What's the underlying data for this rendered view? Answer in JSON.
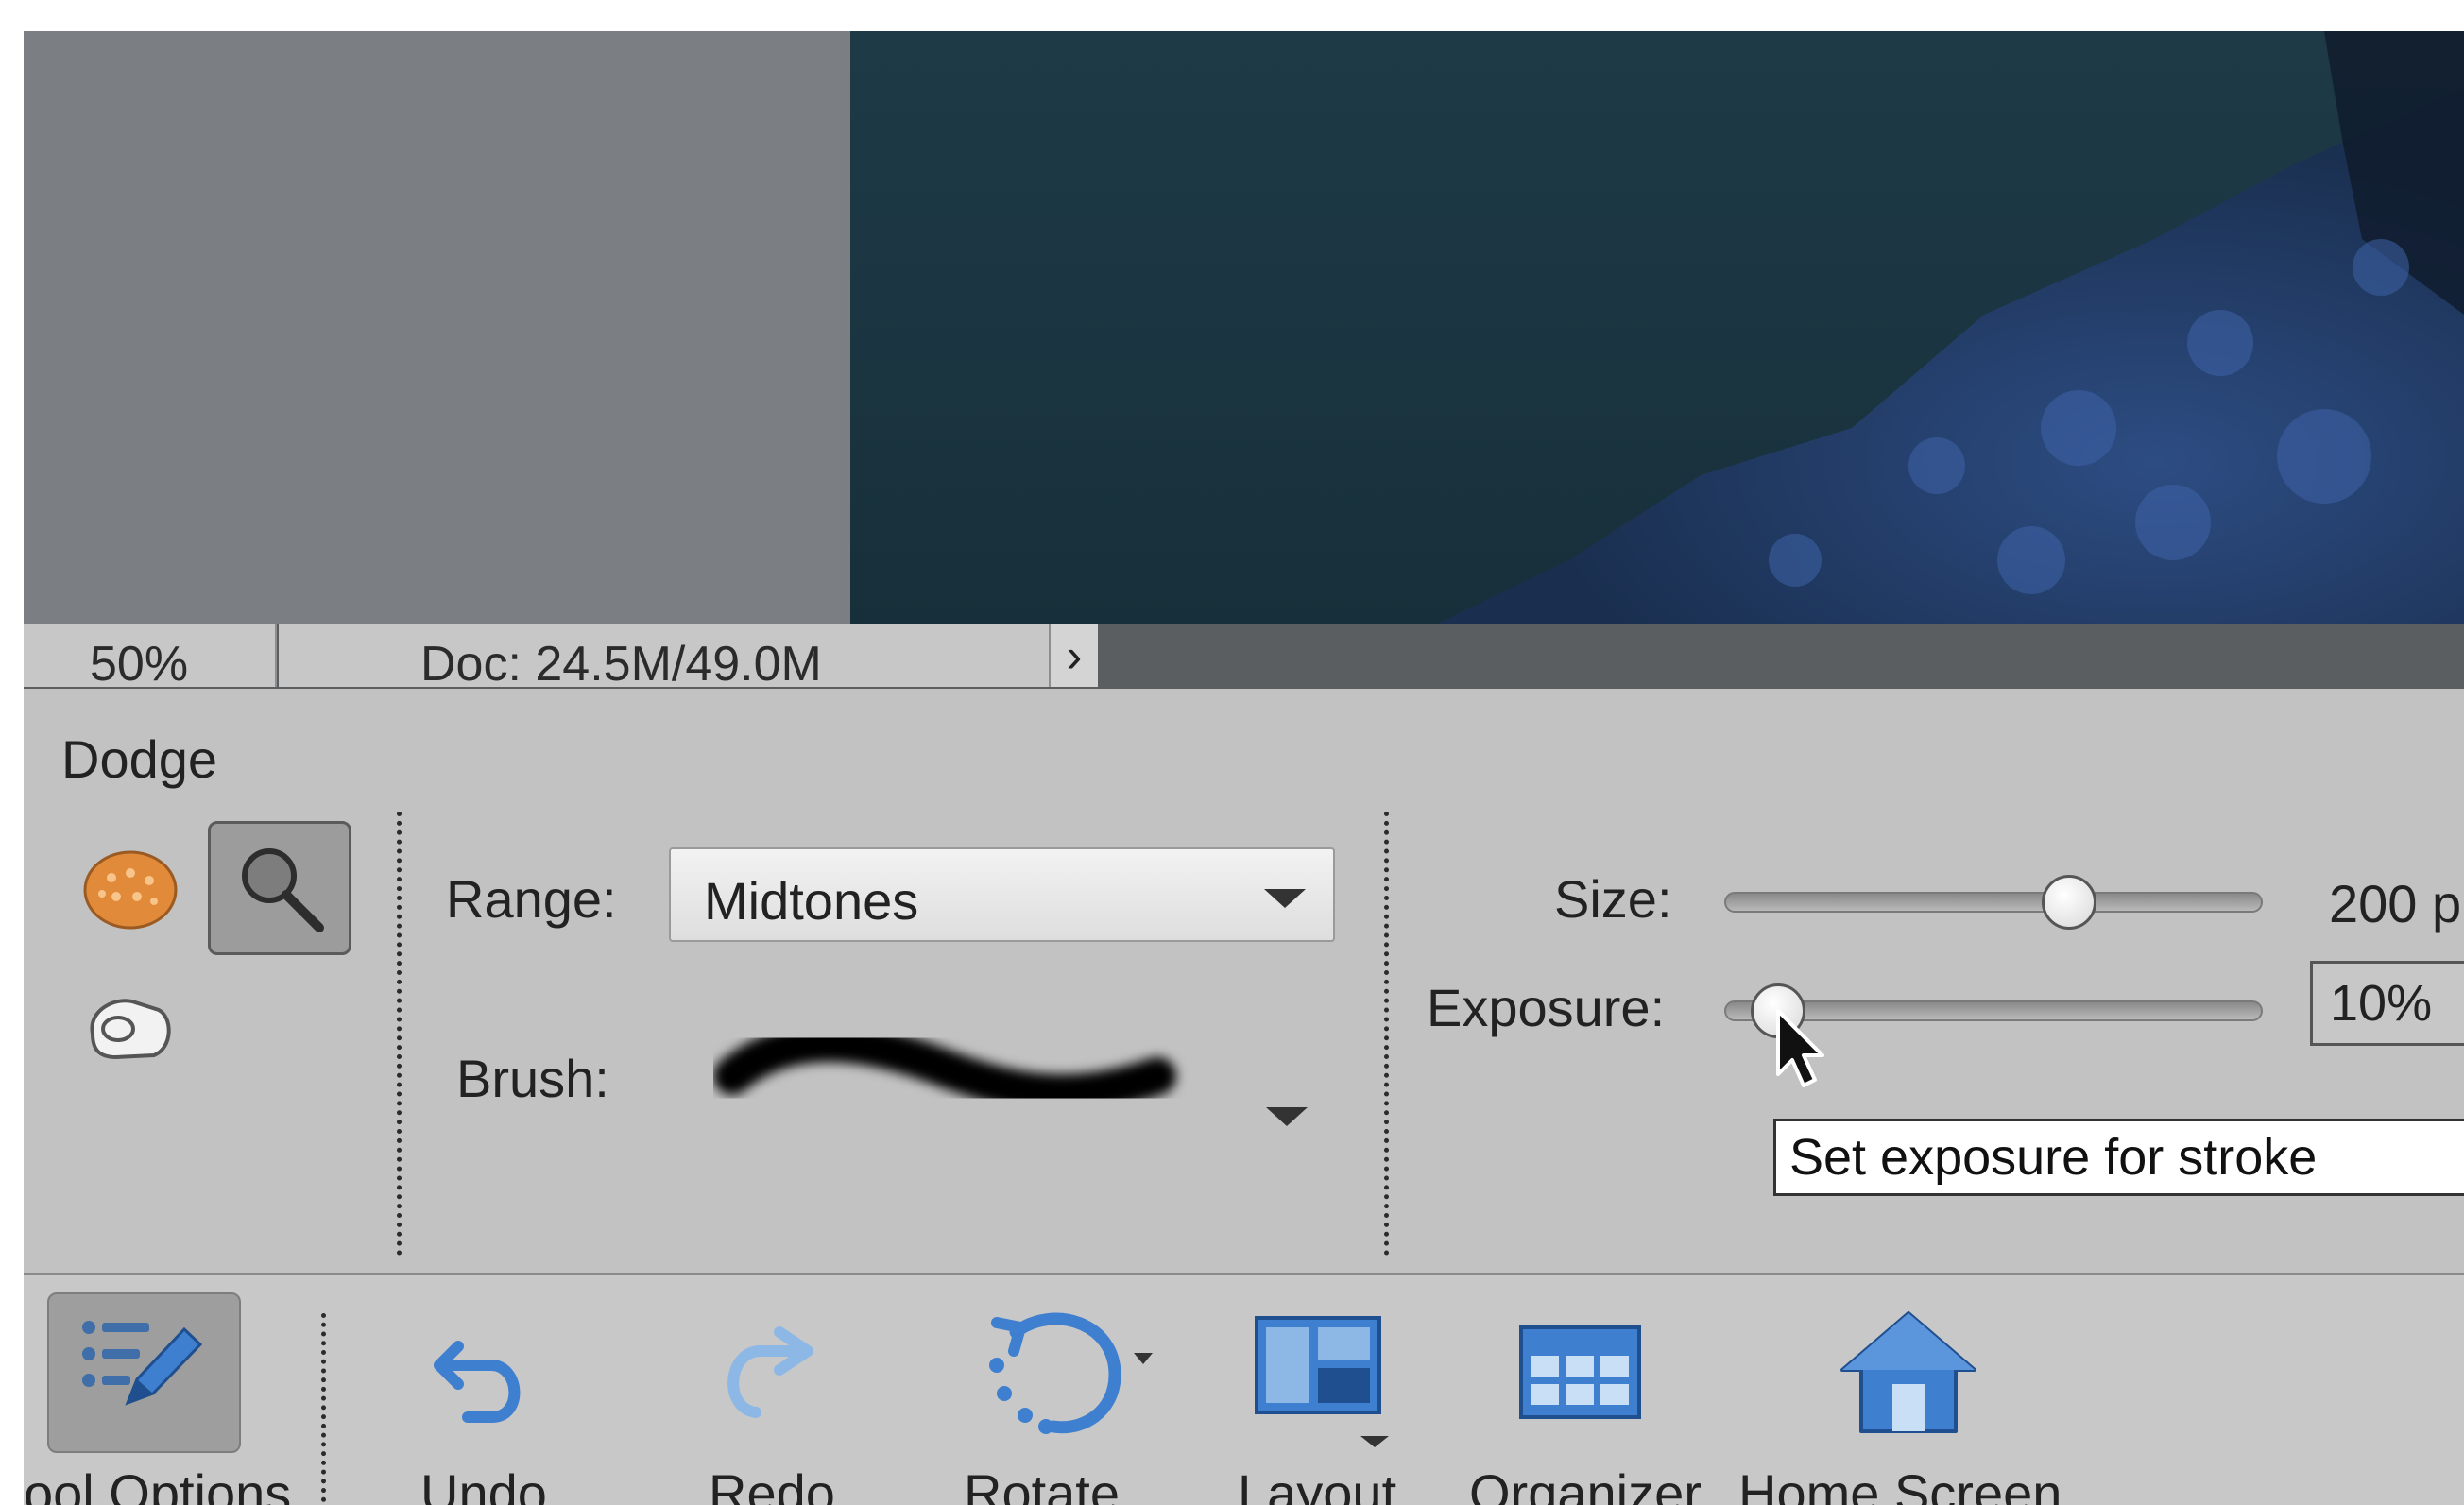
{
  "status_bar": {
    "zoom": "50%",
    "doc_info": "Doc: 24.5M/49.0M",
    "arrow": "›"
  },
  "tool_options": {
    "tool_name": "Dodge",
    "range_label": "Range:",
    "range_value": "Midtones",
    "brush_label": "Brush:",
    "size_label": "Size:",
    "size_value": "200 p",
    "size_level": 0.64,
    "exposure_label": "Exposure:",
    "exposure_value": "10%",
    "exposure_level": 0.1,
    "tooltip": "Set exposure for stroke"
  },
  "taskbar": {
    "items": [
      {
        "label": "ool Options",
        "icon": "tool-options-icon"
      },
      {
        "label": "Undo",
        "icon": "undo-icon"
      },
      {
        "label": "Redo",
        "icon": "redo-icon"
      },
      {
        "label": "Rotate",
        "icon": "rotate-icon"
      },
      {
        "label": "Layout",
        "icon": "layout-icon"
      },
      {
        "label": "Organizer",
        "icon": "organizer-icon"
      },
      {
        "label": "Home Screen",
        "icon": "home-icon"
      }
    ]
  },
  "colors": {
    "canvas_gray": "#7b7f83",
    "panel_gray": "#c2c2c2",
    "accent_blue": "#3f7fd0"
  }
}
